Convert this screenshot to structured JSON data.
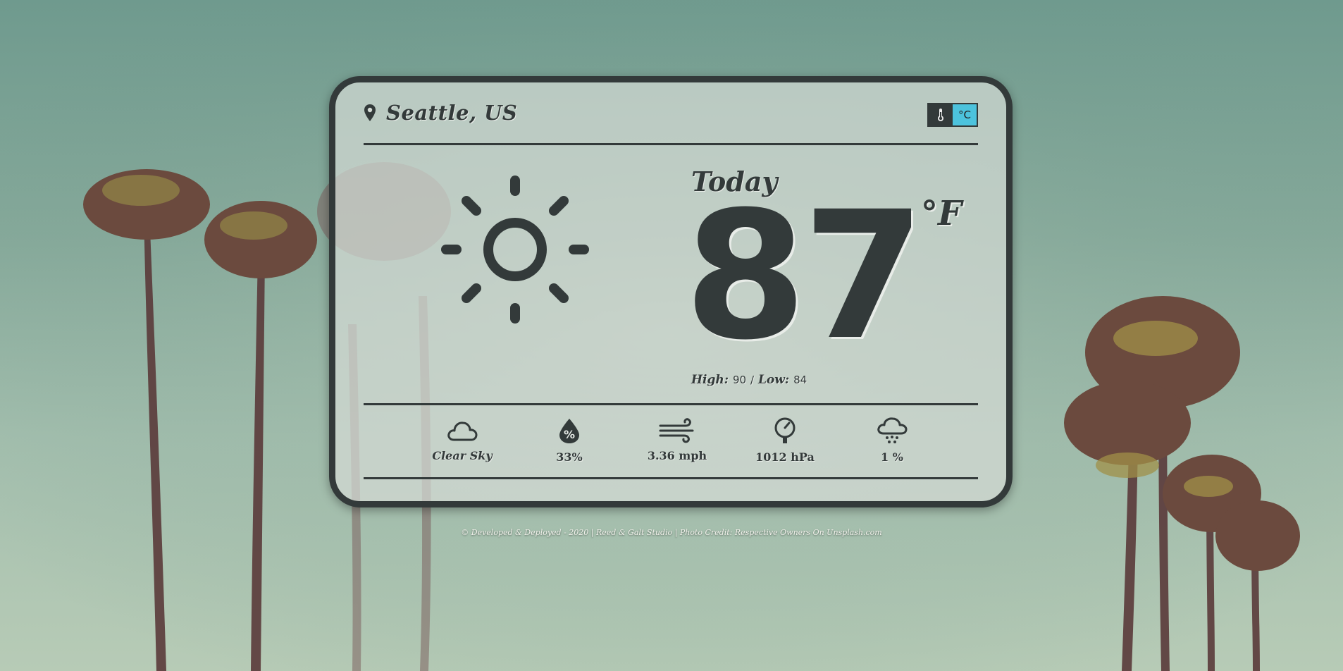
{
  "location": {
    "name": "Seattle, US",
    "icon": "map-pin-icon"
  },
  "unit_toggle": {
    "icon": "thermometer-icon",
    "label": "°C"
  },
  "current": {
    "day_label": "Today",
    "temperature": "87",
    "unit": "°F",
    "high_label": "High:",
    "high_value": "90",
    "separator": "/",
    "low_label": "Low:",
    "low_value": "84",
    "condition_icon": "sun-icon"
  },
  "details": [
    {
      "icon": "cloud-icon",
      "value": "Clear Sky"
    },
    {
      "icon": "humidity-drop-icon",
      "value": "33%"
    },
    {
      "icon": "wind-icon",
      "value": "3.36 mph"
    },
    {
      "icon": "pressure-gauge-icon",
      "value": "1012 hPa"
    },
    {
      "icon": "rain-cloud-icon",
      "value": "1 %"
    }
  ],
  "footer": "© Developed & Deployed - 2020 | Reed & Galt Studio | Photo Credit: Respective Owners On Unsplash.com",
  "colors": {
    "dark": "#333a3a",
    "accent": "#4cc3dd",
    "card": "#d6dcd6"
  }
}
